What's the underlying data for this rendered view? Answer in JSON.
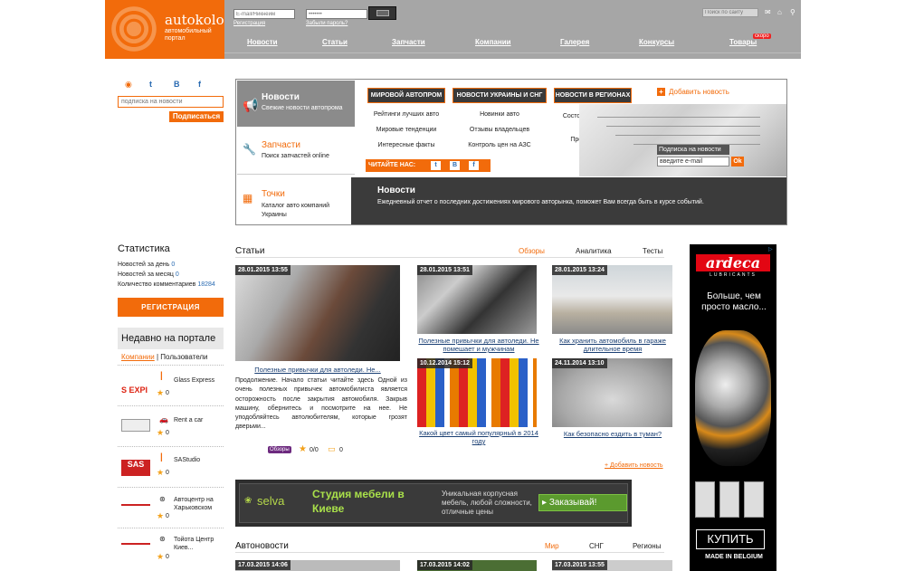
{
  "header": {
    "logo_title": "autokolo",
    "logo_sub": "автомобильный портал",
    "email_placeholder": "E-mail/Никнейм",
    "password_value": "•••••••",
    "register_link": "Регистрация",
    "forgot_link": "Забыли пароль?",
    "search_placeholder": "Поиск по сайту",
    "nav": [
      "Новости",
      "Статьи",
      "Запчасти",
      "Компании",
      "Галерея",
      "Конкурсы",
      "Товары"
    ],
    "new_badge": "скоро"
  },
  "sidebar_top": {
    "subscribe_placeholder": "подписка на новости",
    "subscribe_btn": "Подписаться"
  },
  "panel": {
    "tabs": [
      {
        "title": "Новости",
        "sub": "Свежие новости автопрома"
      },
      {
        "title": "Запчасти",
        "sub": "Поиск запчастей online"
      },
      {
        "title": "Точки",
        "sub": "Каталог авто компаний Украины"
      }
    ],
    "categories": [
      "МИРОВОЙ АВТОПРОМ",
      "НОВОСТИ УКРАИНЫ И СНГ",
      "НОВОСТИ В РЕГИОНАХ"
    ],
    "links": [
      "Рейтинги лучших авто",
      "Мировые тенденции",
      "Интересные факты",
      "Новинки авто",
      "Отзывы владельцев",
      "Контроль цен на АЗС",
      "Состояние и ремонт дорог",
      "Пробки онлайн"
    ],
    "read_us": "ЧИТАЙТЕ НАС:",
    "add_news": "Добавить новость",
    "np_subscribe_label": "Подписка на новости",
    "np_email_value": "введите e-mail",
    "np_ok": "Ok",
    "bottom_title": "Новости",
    "bottom_text": "Ежедневный отчет о последних достижениях мирового авторынка, поможет Вам всегда быть в курсе событий."
  },
  "stats": {
    "title": "Статистика",
    "rows": [
      {
        "label": "Новостей за день",
        "value": "0"
      },
      {
        "label": "Новостей за месяц",
        "value": "0"
      },
      {
        "label": "Количество комментариев",
        "value": "18284"
      }
    ],
    "register_btn": "РЕГИСТРАЦИЯ"
  },
  "recent": {
    "title": "Недавно на портале",
    "tab_companies": "Компании",
    "tab_sep": "|",
    "tab_users": "Пользователи",
    "companies": [
      {
        "name": "Glass Express",
        "rating": "0"
      },
      {
        "name": "Rent a car",
        "rating": "0"
      },
      {
        "name": "SAStudio",
        "rating": "0"
      },
      {
        "name": "Автоцентр на Харьковском",
        "rating": "0"
      },
      {
        "name": "Тойота Центр Киев...",
        "rating": "0"
      }
    ]
  },
  "articles": {
    "title": "Статьи",
    "tabs": [
      "Обзоры",
      "Аналитика",
      "Тесты"
    ],
    "main": {
      "date": "28.01.2015 13:55",
      "caption": "Полезные привычки для автоледи. Не...",
      "text": "Продолжение. Начало статьи читайте здесь Одной из очень полезных привычек автомобилиста является осторожность после закрытия автомобиля. Закрыв машину, обернитесь и посмотрите на нее. Не уподобляйтесь автолюбителям, которые грозят дверьми...",
      "tag": "Обзоры",
      "rating": "0/0",
      "comments": "0"
    },
    "items": [
      {
        "date": "28.01.2015 13:51",
        "caption": "Полезные привычки для автоледи. Не помешает и мужчинам"
      },
      {
        "date": "28.01.2015 13:24",
        "caption": "Как хранить автомобиль в гараже длительное время"
      },
      {
        "date": "10.12.2014 15:12",
        "caption": "Какой цвет самый популярный в 2014 году"
      },
      {
        "date": "24.11.2014 13:10",
        "caption": "Как безопасно ездить в туман?"
      }
    ],
    "add_news": "+ Добавить новость"
  },
  "banner": {
    "brand": "selva",
    "title": "Студия мебели в Киеве",
    "text": "Уникальная корпусная мебель, любой сложности, отличные цены",
    "btn": "Заказывай!"
  },
  "autonews": {
    "title": "Автоновости",
    "tabs": [
      "Мир",
      "СНГ",
      "Регионы"
    ],
    "dates": [
      "17.03.2015 14:06",
      "17.03.2015 14:02",
      "17.03.2015 13:55"
    ]
  },
  "ad": {
    "brand": "ardeca",
    "sub": "LUBRICANTS",
    "text": "Больше, чем просто масло...",
    "buy": "КУПИТЬ",
    "made": "MADE IN BELGIUM"
  },
  "colors": {
    "accent": "#f26b0b",
    "header_gray": "#a6a6a6",
    "dark": "#3b3b3b"
  }
}
